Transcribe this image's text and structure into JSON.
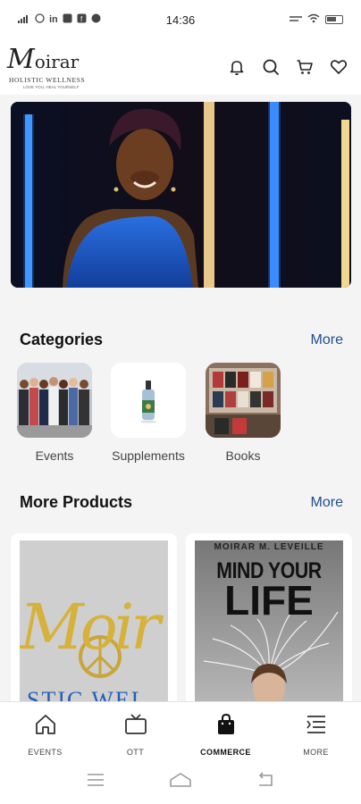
{
  "status": {
    "time": "14:36",
    "left_icons": [
      "signal-icon",
      "whatsapp-icon",
      "linkedin-icon",
      "app-icon",
      "facebook-icon",
      "mail-icon"
    ],
    "right_icons": [
      "data-speed-icon",
      "wifi-icon",
      "battery-icon"
    ]
  },
  "header": {
    "logo": {
      "main_letter": "M",
      "main_rest": "oirar",
      "subtitle": "HOLISTIC WELLNESS",
      "tagline": "LOVE YOU, HEAL YOURSELF"
    },
    "icons": [
      "bell-icon",
      "search-icon",
      "cart-icon",
      "heart-icon"
    ]
  },
  "categories": {
    "title": "Categories",
    "more": "More",
    "items": [
      {
        "label": "Events"
      },
      {
        "label": "Supplements"
      },
      {
        "label": "Books"
      }
    ]
  },
  "products": {
    "title": "More Products",
    "more": "More",
    "items": [
      {
        "logo_letters": "Moir",
        "bottom_text": "STIC WEL"
      },
      {
        "author": "MOIRAR M. LEVEILLE",
        "title_line1": "MIND YOUR",
        "title_line2": "LIFE"
      }
    ]
  },
  "bottom_nav": {
    "items": [
      {
        "label": "EVENTS",
        "icon": "home-icon",
        "active": false
      },
      {
        "label": "OTT",
        "icon": "tv-icon",
        "active": false
      },
      {
        "label": "COMMERCE",
        "icon": "shopping-bag-icon",
        "active": true
      },
      {
        "label": "MORE",
        "icon": "menu-icon",
        "active": false
      }
    ]
  },
  "colors": {
    "accent": "#1f4e8c",
    "hero_blue": "#1a5cc4",
    "gold": "#d6b23a"
  }
}
